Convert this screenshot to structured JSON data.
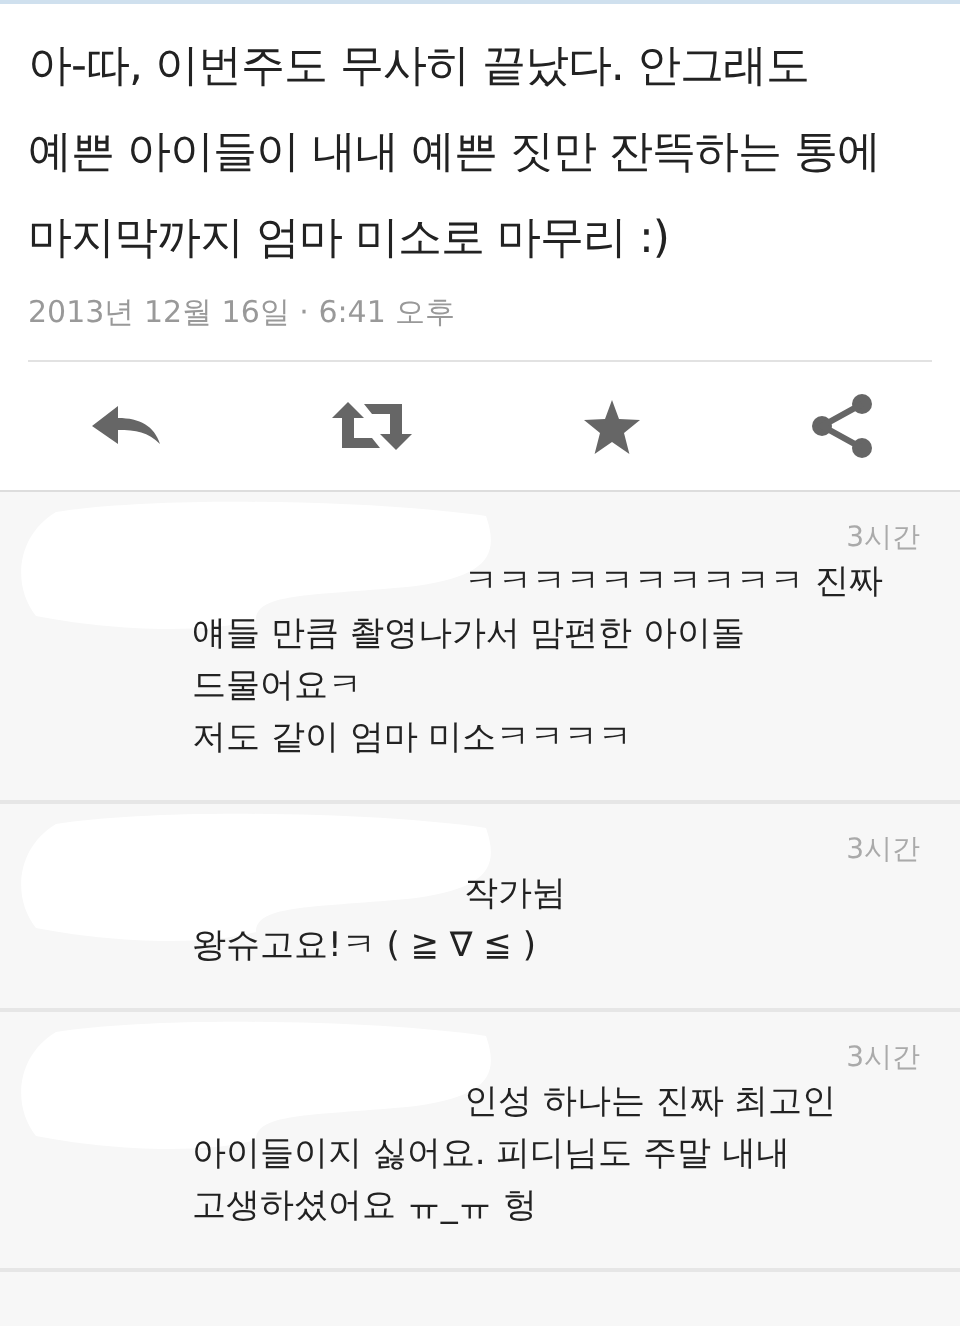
{
  "tweet": {
    "text": "아-따, 이번주도 무사히 끝났다. 안그래도 예쁜 아이들이 내내 예쁜 짓만 잔뜩하는 통에 마지막까지 엄마 미소로 마무리 :)",
    "timestamp": "2013년 12월 16일 · 6:41 오후"
  },
  "actions": [
    {
      "kind": "reply"
    },
    {
      "kind": "retweet"
    },
    {
      "kind": "favorite"
    },
    {
      "kind": "share"
    }
  ],
  "replies": [
    {
      "time": "3시간",
      "redacted": true,
      "lines": [
        "ㅋㅋㅋㅋㅋㅋㅋㅋㅋㅋ 진짜",
        "얘들 만큼 촬영나가서 맘편한 아이돌",
        "드물어요ㅋ",
        "저도 같이 엄마 미소ㅋㅋㅋㅋ"
      ]
    },
    {
      "time": "3시간",
      "redacted": true,
      "lines": [
        "작가뉨",
        "왕슈고요!ㅋ ( ≧ ∇ ≦ )"
      ]
    },
    {
      "time": "3시간",
      "redacted": true,
      "lines": [
        "인성 하나는 진짜 최고인",
        "아이들이지 싫어요. 피디님도 주말 내내",
        "고생하셨어요 ㅠ_ㅠ 헝"
      ]
    }
  ]
}
